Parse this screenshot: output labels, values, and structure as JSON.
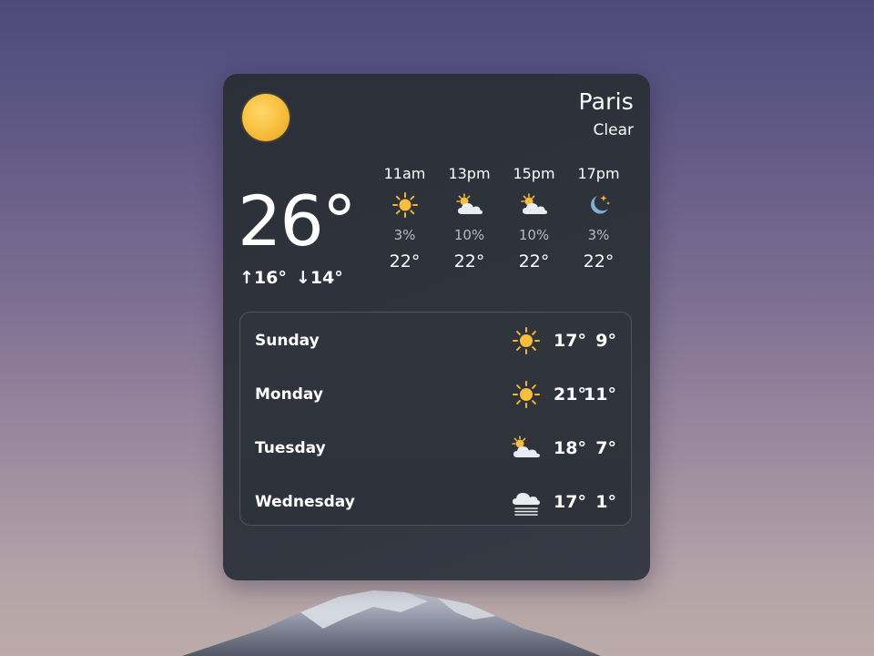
{
  "location": {
    "city": "Paris",
    "condition": "Clear"
  },
  "current": {
    "temperature": "26°",
    "high": "↑16°",
    "low": "↓14°",
    "icon": "sun-icon"
  },
  "hourly": [
    {
      "time": "11am",
      "precip": "3%",
      "temp": "22°",
      "icon": "sun-icon"
    },
    {
      "time": "13pm",
      "precip": "10%",
      "temp": "22°",
      "icon": "partly-cloudy-icon"
    },
    {
      "time": "15pm",
      "precip": "10%",
      "temp": "22°",
      "icon": "partly-cloudy-icon"
    },
    {
      "time": "17pm",
      "precip": "3%",
      "temp": "22°",
      "icon": "moon-stars-icon"
    }
  ],
  "daily": [
    {
      "day": "Sunday",
      "high": "17°",
      "low": "9°",
      "icon": "sun-icon"
    },
    {
      "day": "Monday",
      "high": "21°",
      "low": "11°",
      "icon": "sun-icon"
    },
    {
      "day": "Tuesday",
      "high": "18°",
      "low": "7°",
      "icon": "partly-cloudy-icon"
    },
    {
      "day": "Wednesday",
      "high": "17°",
      "low": "1°",
      "icon": "fog-cloud-icon"
    }
  ],
  "colors": {
    "widget_bg": "#2e323a",
    "sun": "#f8bd3c",
    "cloud": "#e9edf3",
    "moon": "#7fb1d8",
    "precip_text": "#b7bac0"
  }
}
